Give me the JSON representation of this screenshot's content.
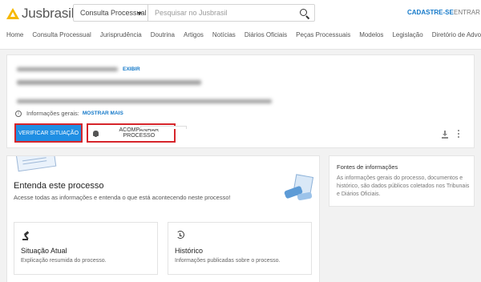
{
  "header": {
    "logo_text": "Jusbrasil",
    "search": {
      "category": "Consulta Processual",
      "placeholder": "Pesquisar no Jusbrasil"
    },
    "signup": "CADASTRE-SE",
    "login": "ENTRAR"
  },
  "nav": [
    "Home",
    "Consulta Processual",
    "Jurisprudência",
    "Doutrina",
    "Artigos",
    "Notícias",
    "Diários Oficiais",
    "Peças Processuais",
    "Modelos",
    "Legislação",
    "Diretório de Advogados"
  ],
  "case": {
    "show_link": "EXIBIR",
    "info_label": "Informações gerais:",
    "show_more": "MOSTRAR MAIS",
    "verify_button": "VERIFICAR SITUAÇÃO",
    "follow_button": "ACOMPANHAR PROCESSO"
  },
  "understand": {
    "title": "Entenda este processo",
    "subtitle": "Acesse todas as informações e entenda o que está acontecendo neste processo!",
    "cards": [
      {
        "title": "Situação Atual",
        "desc": "Explicação resumida do processo."
      },
      {
        "title": "Histórico",
        "desc": "Informações publicadas sobre o processo."
      }
    ]
  },
  "sources": {
    "title": "Fontes de informações",
    "body": "As informações gerais do processo, documentos e histórico, são dados públicos coletados nos Tribunais e Diários Oficiais."
  },
  "colors": {
    "brand_yellow": "#f6b800",
    "link_blue": "#1479c9",
    "button_blue": "#1f8ee3",
    "highlight_red": "#d6252b"
  }
}
